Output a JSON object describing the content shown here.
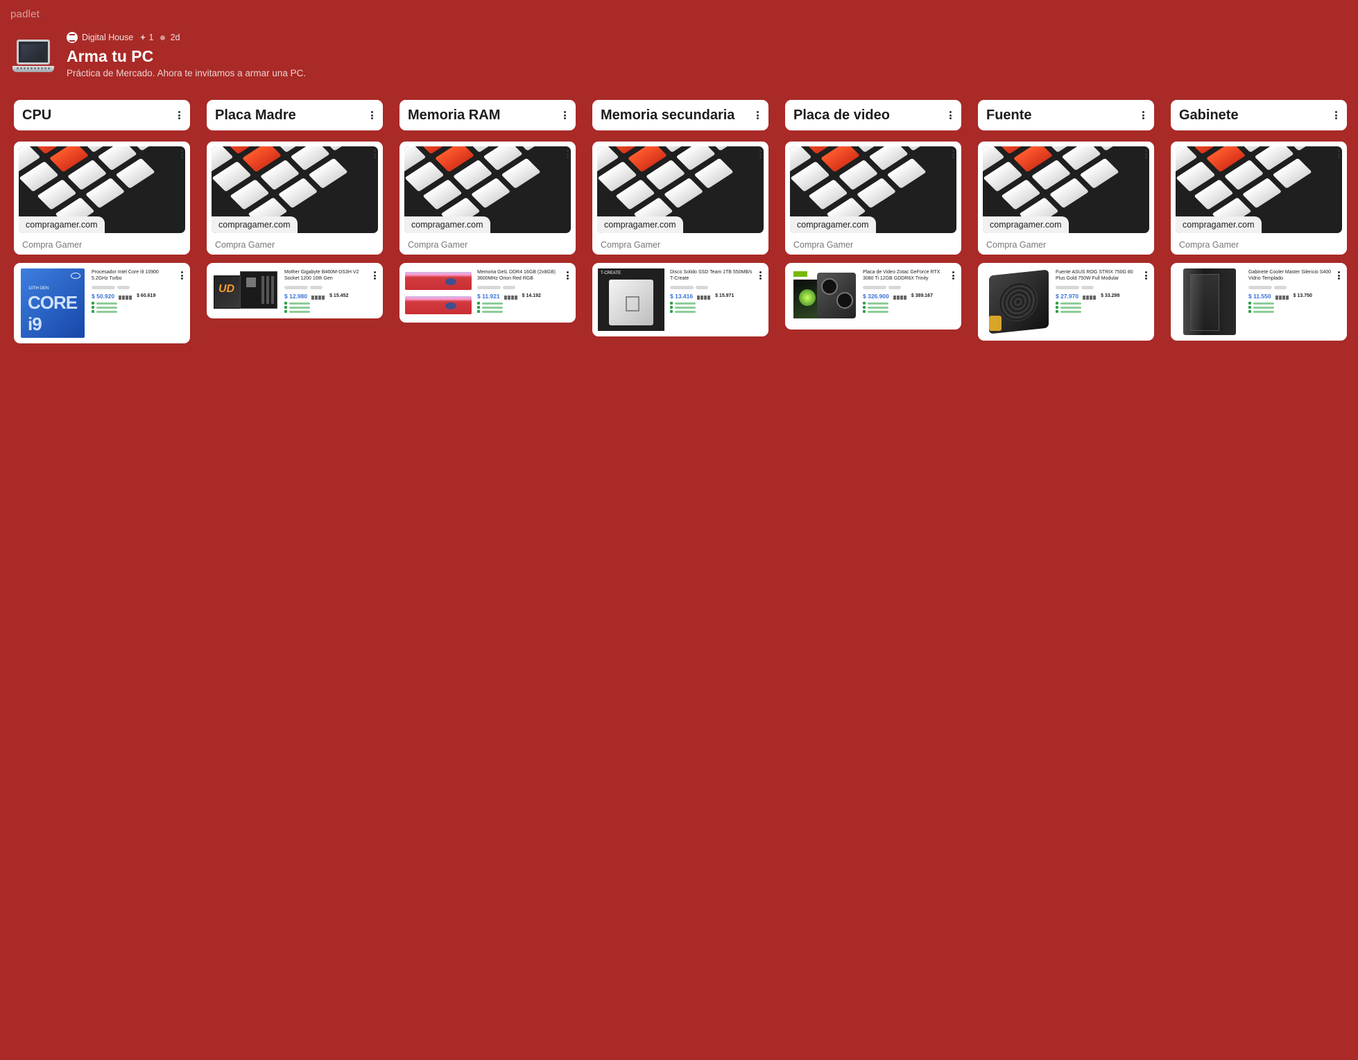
{
  "brand": "padlet",
  "header": {
    "org": "Digital House",
    "plus": "+",
    "collaborators": "1",
    "age": "2d",
    "title": "Arma tu PC",
    "subtitle": "Práctica de Mercado. Ahora te invitamos a armar una PC."
  },
  "columns": [
    {
      "title": "CPU",
      "link": {
        "domain": "compragamer.com",
        "source": "Compra Gamer"
      },
      "product": {
        "name": "Procesador Intel Core i9 10900 5.2GHz Turbo",
        "price": "$ 50.920",
        "price2": "$ 60.619",
        "image": "cpu-box-image",
        "img_text": "CORE i9"
      }
    },
    {
      "title": "Placa Madre",
      "link": {
        "domain": "compragamer.com",
        "source": "Compra Gamer"
      },
      "product": {
        "name": "Mother Gigabyte B460M-DS3H V2 Socket 1200 10th Gen",
        "price": "$ 12.980",
        "price2": "$ 15.452",
        "image": "motherboard-image"
      }
    },
    {
      "title": "Memoria RAM",
      "link": {
        "domain": "compragamer.com",
        "source": "Compra Gamer"
      },
      "product": {
        "name": "Memoria GeIL DDR4 16GB (2x8GB) 3600MHz Orion Red RGB",
        "price": "$ 11.921",
        "price2": "$ 14.192",
        "image": "ram-image"
      }
    },
    {
      "title": "Memoria secundaria",
      "link": {
        "domain": "compragamer.com",
        "source": "Compra Gamer"
      },
      "product": {
        "name": "Disco Solido SSD Team 1TB 550MB/s T-Create",
        "price": "$ 13.416",
        "price2": "$ 15.971",
        "image": "ssd-image",
        "img_text": "T-CREATE"
      }
    },
    {
      "title": "Placa de video",
      "link": {
        "domain": "compragamer.com",
        "source": "Compra Gamer"
      },
      "product": {
        "name": "Placa de Video Zotac GeForce RTX 3080 Ti 12GB GDDR6X Trinity",
        "price": "$ 326.900",
        "price2": "$ 389.167",
        "image": "gpu-image"
      }
    },
    {
      "title": "Fuente",
      "link": {
        "domain": "compragamer.com",
        "source": "Compra Gamer"
      },
      "product": {
        "name": "Fuente ASUS ROG STRIX 750G 80 Plus Gold 750W Full Modular",
        "price": "$ 27.970",
        "price2": "$ 33.298",
        "image": "psu-image"
      }
    },
    {
      "title": "Gabinete",
      "link": {
        "domain": "compragamer.com",
        "source": "Compra Gamer"
      },
      "product": {
        "name": "Gabinete Cooler Master Silencio S400 Vidrio Templado",
        "price": "$ 11.550",
        "price2": "$ 13.750",
        "image": "case-image"
      }
    }
  ],
  "colors": {
    "background": "#a92a27",
    "card": "#ffffff",
    "price": "#3b72d9",
    "accent_tile": "#ff5a2e"
  }
}
